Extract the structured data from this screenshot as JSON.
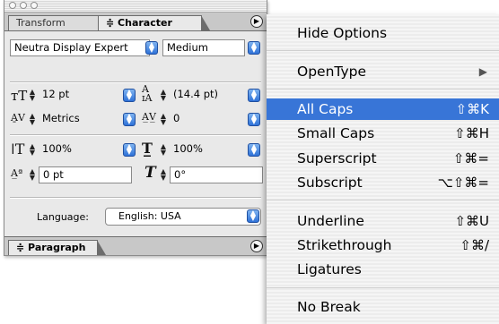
{
  "palette": {
    "tabs": {
      "transform": "Transform",
      "character": "≑ Character",
      "paragraph": "≑ Paragraph"
    },
    "font_family": "Neutra Display Expert",
    "font_style": "Medium",
    "font_size": "12 pt",
    "leading": "(14.4 pt)",
    "kerning": "Metrics",
    "tracking": "0",
    "vertical_scale": "100%",
    "horizontal_scale": "100%",
    "baseline_shift": "0 pt",
    "rotation": "0°",
    "language_label": "Language:",
    "language_value": "English: USA"
  },
  "menu": {
    "items": [
      {
        "label": "Hide Options",
        "shortcut": ""
      },
      {
        "label": "OpenType",
        "shortcut": "▶"
      },
      {
        "label": "All Caps",
        "shortcut": "⇧⌘K"
      },
      {
        "label": "Small Caps",
        "shortcut": "⇧⌘H"
      },
      {
        "label": "Superscript",
        "shortcut": "⇧⌘="
      },
      {
        "label": "Subscript",
        "shortcut": "⌥⇧⌘="
      },
      {
        "label": "Underline",
        "shortcut": "⇧⌘U"
      },
      {
        "label": "Strikethrough",
        "shortcut": "⇧⌘/"
      },
      {
        "label": "Ligatures",
        "shortcut": ""
      },
      {
        "label": "No Break",
        "shortcut": ""
      }
    ]
  },
  "colors": {
    "highlight": "#3875d7"
  }
}
